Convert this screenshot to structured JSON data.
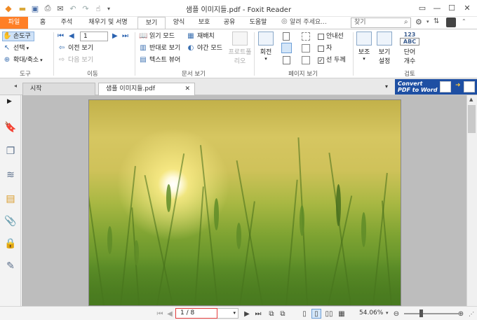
{
  "window": {
    "title": "샘플 이미지들.pdf - Foxit Reader",
    "minimize": "—",
    "maximize": "☐",
    "close": "✕"
  },
  "quick_access": [
    "foxit-logo",
    "open",
    "save",
    "print",
    "email",
    "undo",
    "redo",
    "hand-tool"
  ],
  "menu_tabs": [
    "파일",
    "홈",
    "주석",
    "채우기 및 서명",
    "보기",
    "양식",
    "보호",
    "공유",
    "도움말"
  ],
  "active_tab": "보기",
  "help_search": "알려 주세요...",
  "search": {
    "placeholder": "찾기"
  },
  "ribbon": {
    "tools": {
      "hand": "손도구",
      "select": "선택",
      "zoom": "확대/축소",
      "label": "도구"
    },
    "go": {
      "page_value": "1",
      "prev_view": "이전 보기",
      "next_view": "다음 보기",
      "label": "이동"
    },
    "doc_view": {
      "read_mode": "읽기 모드",
      "reverse_view": "반대로 보기",
      "text_viewer": "텍스트 뷰어",
      "reflow": "재배치",
      "night_mode": "야간 모드",
      "presentation": "프로트풀",
      "presentation2": "리오",
      "label": "문서 보기"
    },
    "page_display": {
      "rotate": "회전",
      "guides": "안내선",
      "ruler": "자",
      "line_weight": "선 두께",
      "label": "페이지 보기"
    },
    "assist": {
      "assist": "보조",
      "view_settings": "보기",
      "view_settings2": "설정",
      "word_count": "단어",
      "word_count2": "개수",
      "review_label": "검토",
      "icon_text1": "123",
      "icon_text2": "ABC"
    }
  },
  "doc_tabs": {
    "start": "시작",
    "current": "샘플 이미지들.pdf"
  },
  "ad": {
    "line1": "Convert",
    "line2": "PDF to Word"
  },
  "status": {
    "page": "1 / 8",
    "zoom": "54.06%"
  },
  "colors": {
    "file_tab": "#ff7f27",
    "ad_banner": "#1e4fa3",
    "page_input_border": "#e23b3b"
  }
}
